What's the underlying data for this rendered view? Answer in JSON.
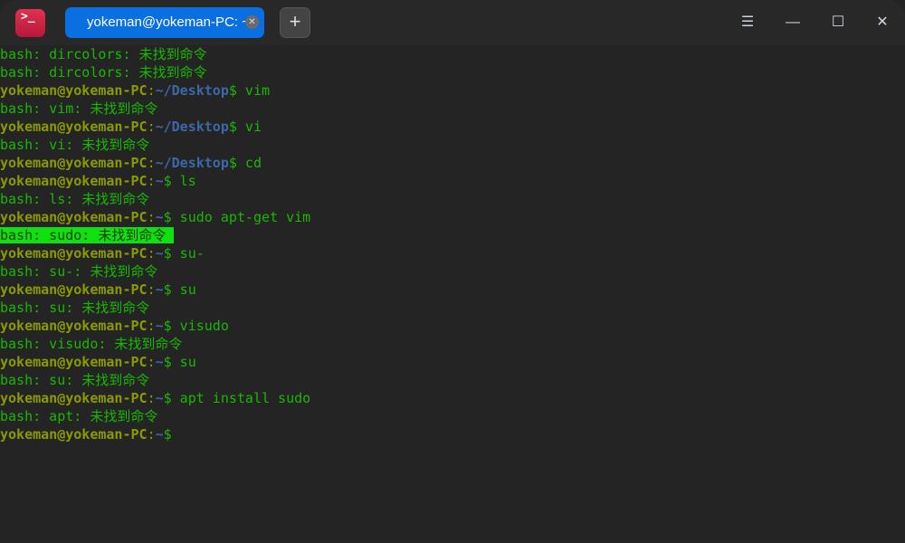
{
  "window": {
    "tab_title": "yokeman@yokeman-PC: ~",
    "app_icon": ">_"
  },
  "terminal": {
    "user_host": "yokeman@yokeman-PC",
    "lines": [
      {
        "type": "out",
        "text": "bash: dircolors: 未找到命令"
      },
      {
        "type": "out",
        "text": "bash: dircolors: 未找到命令"
      },
      {
        "type": "prompt",
        "path": "~/Desktop",
        "cmd": " vim"
      },
      {
        "type": "out",
        "text": "bash: vim: 未找到命令"
      },
      {
        "type": "prompt",
        "path": "~/Desktop",
        "cmd": " vi"
      },
      {
        "type": "out",
        "text": "bash: vi: 未找到命令"
      },
      {
        "type": "prompt",
        "path": "~/Desktop",
        "cmd": " cd"
      },
      {
        "type": "prompt",
        "path": "~",
        "cmd": " ls"
      },
      {
        "type": "out",
        "text": "bash: ls: 未找到命令"
      },
      {
        "type": "prompt",
        "path": "~",
        "cmd": " sudo apt-get vim"
      },
      {
        "type": "out",
        "text": "bash: sudo: 未找到命令 ",
        "highlight": true
      },
      {
        "type": "prompt",
        "path": "~",
        "cmd": " su-"
      },
      {
        "type": "out",
        "text": "bash: su-: 未找到命令"
      },
      {
        "type": "prompt",
        "path": "~",
        "cmd": " su"
      },
      {
        "type": "out",
        "text": "bash: su: 未找到命令"
      },
      {
        "type": "prompt",
        "path": "~",
        "cmd": " visudo"
      },
      {
        "type": "out",
        "text": "bash: visudo: 未找到命令"
      },
      {
        "type": "prompt",
        "path": "~",
        "cmd": " su"
      },
      {
        "type": "out",
        "text": "bash: su: 未找到命令"
      },
      {
        "type": "prompt",
        "path": "~",
        "cmd": " apt install sudo"
      },
      {
        "type": "out",
        "text": "bash: apt: 未找到命令"
      },
      {
        "type": "prompt",
        "path": "~",
        "cmd": ""
      }
    ]
  }
}
